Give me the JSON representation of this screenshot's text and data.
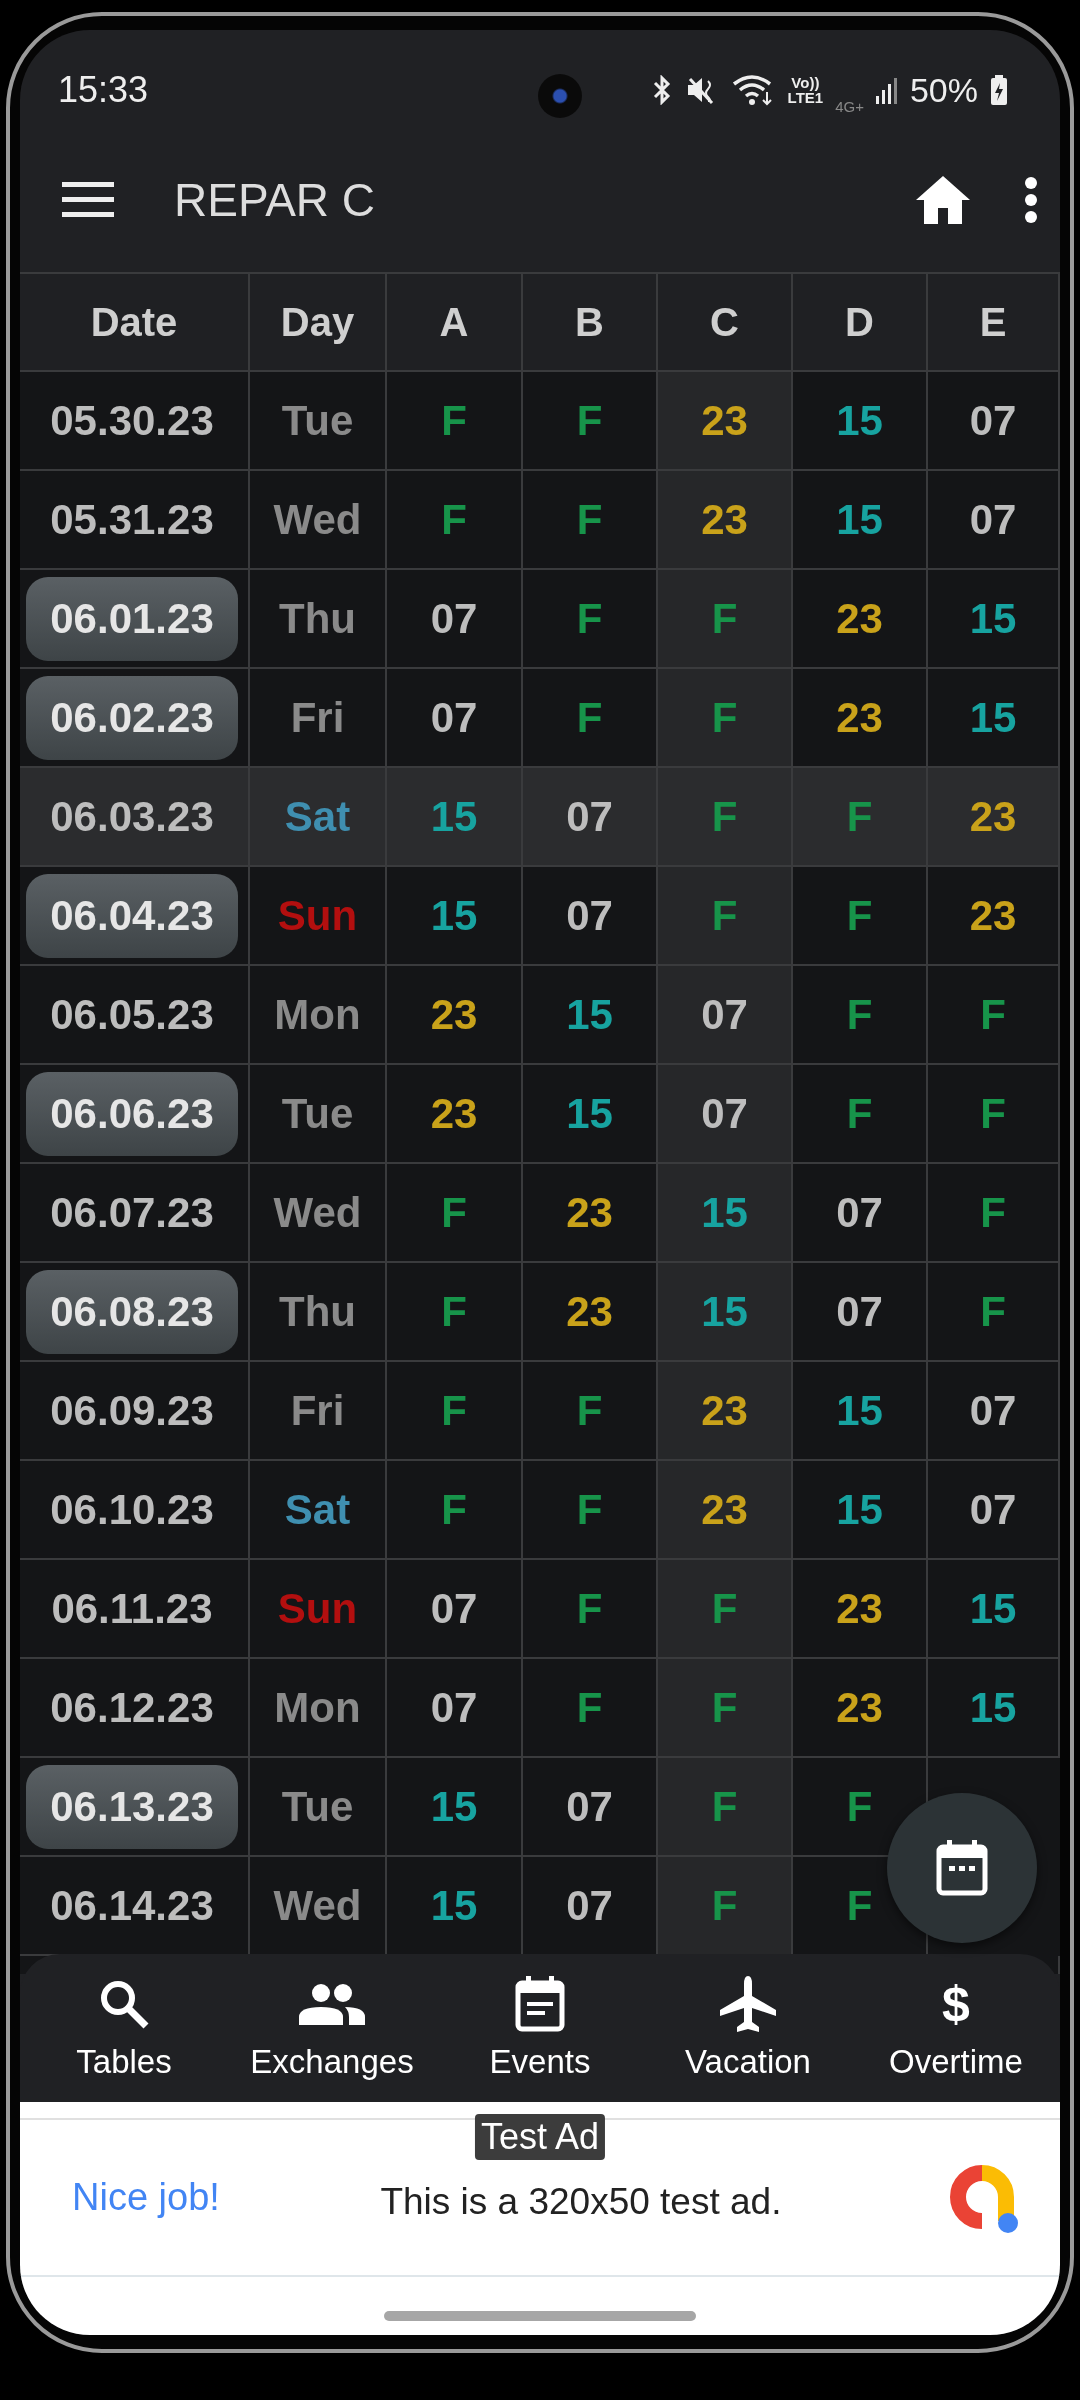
{
  "status_bar": {
    "time": "15:33",
    "volte_top": "Vo))",
    "volte_bottom": "LTE1",
    "network": "4G+",
    "battery": "50%"
  },
  "toolbar": {
    "title": "REPAR C"
  },
  "table": {
    "columns": [
      {
        "label": "Date",
        "highlighted": false
      },
      {
        "label": "Day",
        "highlighted": false
      },
      {
        "label": "A",
        "highlighted": false
      },
      {
        "label": "B",
        "highlighted": false
      },
      {
        "label": "C",
        "highlighted": true
      },
      {
        "label": "D",
        "highlighted": false
      },
      {
        "label": "E",
        "highlighted": false
      }
    ],
    "rows": [
      {
        "date": "05.30.23",
        "marked": false,
        "highlighted": false,
        "day": {
          "text": "Tue",
          "color": "#8a8a8a"
        },
        "shifts": [
          {
            "text": "F",
            "color": "#17944a"
          },
          {
            "text": "F",
            "color": "#17944a"
          },
          {
            "text": "23",
            "color": "#c9a21a"
          },
          {
            "text": "15",
            "color": "#17a3a0"
          },
          {
            "text": "07",
            "color": "#bdbdbd"
          }
        ]
      },
      {
        "date": "05.31.23",
        "marked": false,
        "highlighted": false,
        "day": {
          "text": "Wed",
          "color": "#8a8a8a"
        },
        "shifts": [
          {
            "text": "F",
            "color": "#17944a"
          },
          {
            "text": "F",
            "color": "#17944a"
          },
          {
            "text": "23",
            "color": "#c9a21a"
          },
          {
            "text": "15",
            "color": "#17a3a0"
          },
          {
            "text": "07",
            "color": "#bdbdbd"
          }
        ]
      },
      {
        "date": "06.01.23",
        "marked": true,
        "highlighted": false,
        "day": {
          "text": "Thu",
          "color": "#8a8a8a"
        },
        "shifts": [
          {
            "text": "07",
            "color": "#bdbdbd"
          },
          {
            "text": "F",
            "color": "#17944a"
          },
          {
            "text": "F",
            "color": "#17944a"
          },
          {
            "text": "23",
            "color": "#c9a21a"
          },
          {
            "text": "15",
            "color": "#17a3a0"
          }
        ]
      },
      {
        "date": "06.02.23",
        "marked": true,
        "highlighted": false,
        "day": {
          "text": "Fri",
          "color": "#8a8a8a"
        },
        "shifts": [
          {
            "text": "07",
            "color": "#bdbdbd"
          },
          {
            "text": "F",
            "color": "#17944a"
          },
          {
            "text": "F",
            "color": "#17944a"
          },
          {
            "text": "23",
            "color": "#c9a21a"
          },
          {
            "text": "15",
            "color": "#17a3a0"
          }
        ]
      },
      {
        "date": "06.03.23",
        "marked": false,
        "highlighted": true,
        "day": {
          "text": "Sat",
          "color": "#3f8fb0"
        },
        "shifts": [
          {
            "text": "15",
            "color": "#17a3a0"
          },
          {
            "text": "07",
            "color": "#bdbdbd"
          },
          {
            "text": "F",
            "color": "#17944a"
          },
          {
            "text": "F",
            "color": "#17944a"
          },
          {
            "text": "23",
            "color": "#c9a21a"
          }
        ]
      },
      {
        "date": "06.04.23",
        "marked": true,
        "highlighted": false,
        "day": {
          "text": "Sun",
          "color": "#b30f0f"
        },
        "shifts": [
          {
            "text": "15",
            "color": "#17a3a0"
          },
          {
            "text": "07",
            "color": "#bdbdbd"
          },
          {
            "text": "F",
            "color": "#17944a"
          },
          {
            "text": "F",
            "color": "#17944a"
          },
          {
            "text": "23",
            "color": "#c9a21a"
          }
        ]
      },
      {
        "date": "06.05.23",
        "marked": false,
        "highlighted": false,
        "day": {
          "text": "Mon",
          "color": "#8a8a8a"
        },
        "shifts": [
          {
            "text": "23",
            "color": "#c9a21a"
          },
          {
            "text": "15",
            "color": "#17a3a0"
          },
          {
            "text": "07",
            "color": "#bdbdbd"
          },
          {
            "text": "F",
            "color": "#17944a"
          },
          {
            "text": "F",
            "color": "#17944a"
          }
        ]
      },
      {
        "date": "06.06.23",
        "marked": true,
        "highlighted": false,
        "day": {
          "text": "Tue",
          "color": "#8a8a8a"
        },
        "shifts": [
          {
            "text": "23",
            "color": "#c9a21a"
          },
          {
            "text": "15",
            "color": "#17a3a0"
          },
          {
            "text": "07",
            "color": "#bdbdbd"
          },
          {
            "text": "F",
            "color": "#17944a"
          },
          {
            "text": "F",
            "color": "#17944a"
          }
        ]
      },
      {
        "date": "06.07.23",
        "marked": false,
        "highlighted": false,
        "day": {
          "text": "Wed",
          "color": "#8a8a8a"
        },
        "shifts": [
          {
            "text": "F",
            "color": "#17944a"
          },
          {
            "text": "23",
            "color": "#c9a21a"
          },
          {
            "text": "15",
            "color": "#17a3a0"
          },
          {
            "text": "07",
            "color": "#bdbdbd"
          },
          {
            "text": "F",
            "color": "#17944a"
          }
        ]
      },
      {
        "date": "06.08.23",
        "marked": true,
        "highlighted": false,
        "day": {
          "text": "Thu",
          "color": "#8a8a8a"
        },
        "shifts": [
          {
            "text": "F",
            "color": "#17944a"
          },
          {
            "text": "23",
            "color": "#c9a21a"
          },
          {
            "text": "15",
            "color": "#17a3a0"
          },
          {
            "text": "07",
            "color": "#bdbdbd"
          },
          {
            "text": "F",
            "color": "#17944a"
          }
        ]
      },
      {
        "date": "06.09.23",
        "marked": false,
        "highlighted": false,
        "day": {
          "text": "Fri",
          "color": "#8a8a8a"
        },
        "shifts": [
          {
            "text": "F",
            "color": "#17944a"
          },
          {
            "text": "F",
            "color": "#17944a"
          },
          {
            "text": "23",
            "color": "#c9a21a"
          },
          {
            "text": "15",
            "color": "#17a3a0"
          },
          {
            "text": "07",
            "color": "#bdbdbd"
          }
        ]
      },
      {
        "date": "06.10.23",
        "marked": false,
        "highlighted": false,
        "day": {
          "text": "Sat",
          "color": "#3f8fb0"
        },
        "shifts": [
          {
            "text": "F",
            "color": "#17944a"
          },
          {
            "text": "F",
            "color": "#17944a"
          },
          {
            "text": "23",
            "color": "#c9a21a"
          },
          {
            "text": "15",
            "color": "#17a3a0"
          },
          {
            "text": "07",
            "color": "#bdbdbd"
          }
        ]
      },
      {
        "date": "06.11.23",
        "marked": false,
        "highlighted": false,
        "day": {
          "text": "Sun",
          "color": "#b30f0f"
        },
        "shifts": [
          {
            "text": "07",
            "color": "#bdbdbd"
          },
          {
            "text": "F",
            "color": "#17944a"
          },
          {
            "text": "F",
            "color": "#17944a"
          },
          {
            "text": "23",
            "color": "#c9a21a"
          },
          {
            "text": "15",
            "color": "#17a3a0"
          }
        ]
      },
      {
        "date": "06.12.23",
        "marked": false,
        "highlighted": false,
        "day": {
          "text": "Mon",
          "color": "#8a8a8a"
        },
        "shifts": [
          {
            "text": "07",
            "color": "#bdbdbd"
          },
          {
            "text": "F",
            "color": "#17944a"
          },
          {
            "text": "F",
            "color": "#17944a"
          },
          {
            "text": "23",
            "color": "#c9a21a"
          },
          {
            "text": "15",
            "color": "#17a3a0"
          }
        ]
      },
      {
        "date": "06.13.23",
        "marked": true,
        "highlighted": false,
        "day": {
          "text": "Tue",
          "color": "#8a8a8a"
        },
        "shifts": [
          {
            "text": "15",
            "color": "#17a3a0"
          },
          {
            "text": "07",
            "color": "#bdbdbd"
          },
          {
            "text": "F",
            "color": "#17944a"
          },
          {
            "text": "F",
            "color": "#17944a"
          }
        ]
      },
      {
        "date": "06.14.23",
        "marked": false,
        "highlighted": false,
        "day": {
          "text": "Wed",
          "color": "#8a8a8a"
        },
        "shifts": [
          {
            "text": "15",
            "color": "#17a3a0"
          },
          {
            "text": "07",
            "color": "#bdbdbd"
          },
          {
            "text": "F",
            "color": "#17944a"
          },
          {
            "text": "F",
            "color": "#17944a"
          }
        ]
      }
    ]
  },
  "bottom_nav": [
    {
      "kind": "search",
      "label": "Tables"
    },
    {
      "kind": "people",
      "label": "Exchanges"
    },
    {
      "kind": "event",
      "label": "Events"
    },
    {
      "kind": "airplane",
      "label": "Vacation"
    },
    {
      "kind": "glyph",
      "glyph": "$",
      "label": "Overtime"
    }
  ],
  "ad": {
    "tag": "Test Ad",
    "headline": "Nice job!",
    "text": "This is a 320x50 test ad."
  }
}
